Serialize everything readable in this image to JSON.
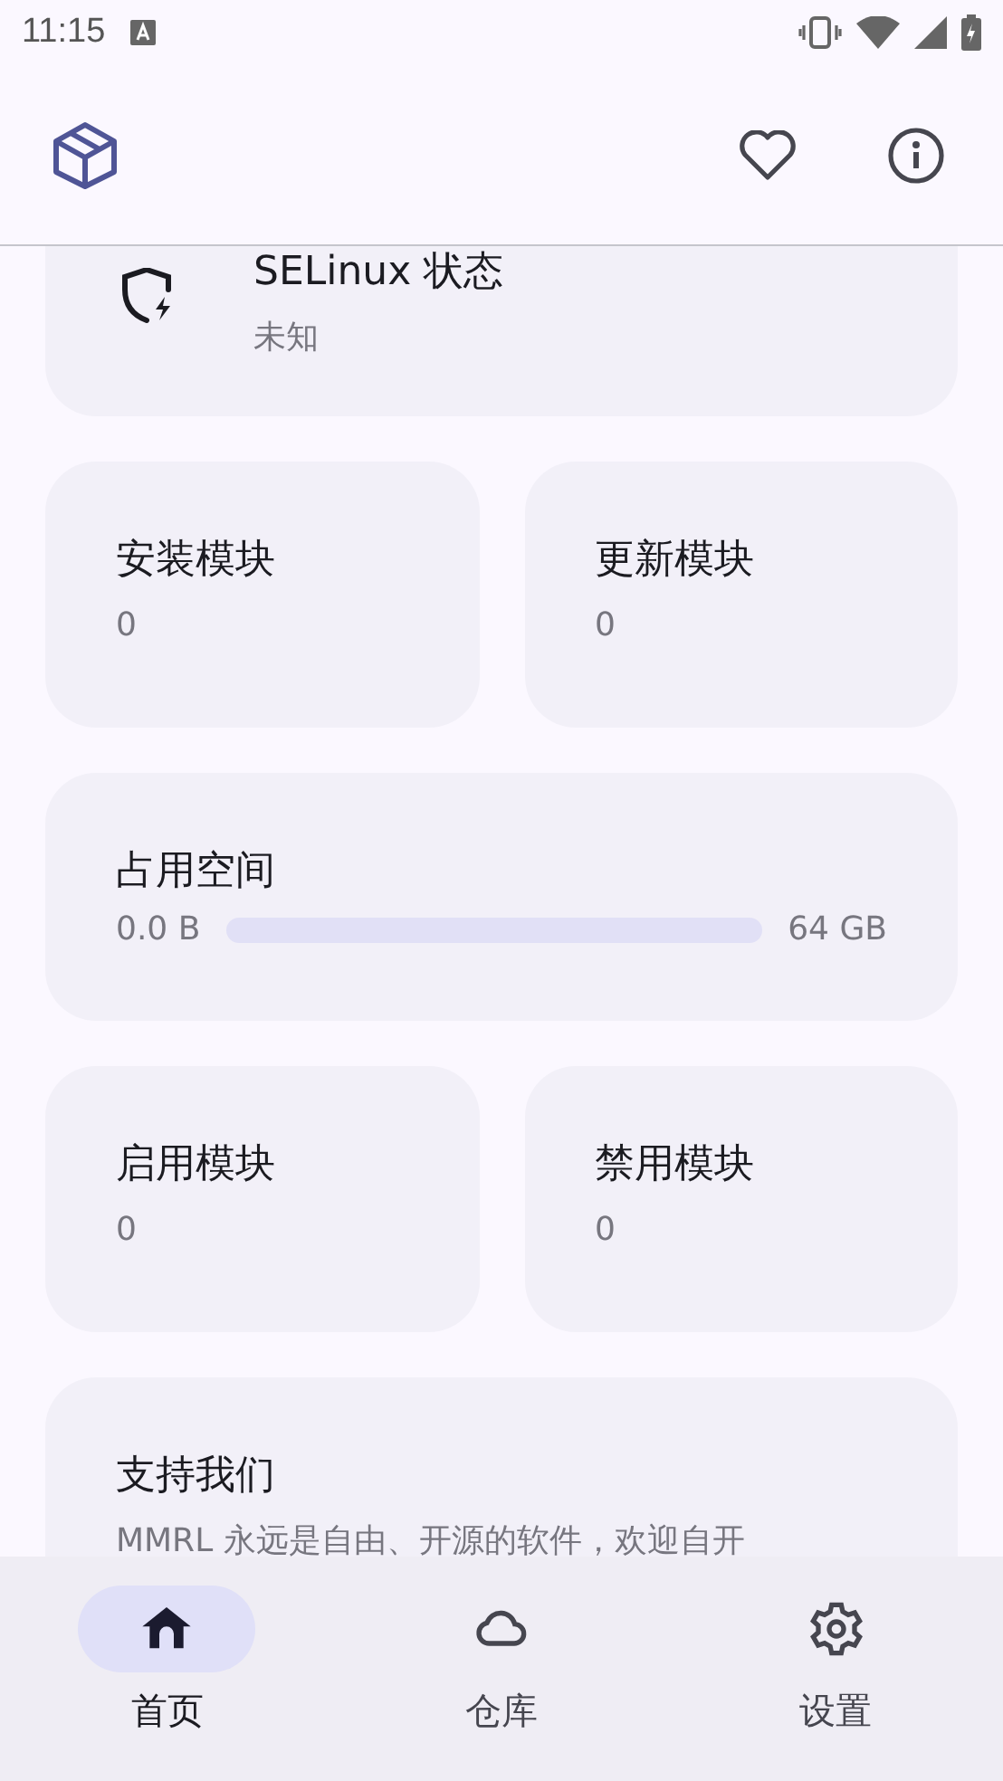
{
  "status_bar": {
    "time": "11:15"
  },
  "selinux_card": {
    "title": "SELinux 状态",
    "value": "未知"
  },
  "stat_rows": [
    [
      {
        "title": "安装模块",
        "value": "0"
      },
      {
        "title": "更新模块",
        "value": "0"
      }
    ]
  ],
  "storage_card": {
    "title": "占用空间",
    "used": "0.0 B",
    "total": "64 GB",
    "level": 0
  },
  "stat_rows_2": [
    [
      {
        "title": "启用模块",
        "value": "0"
      },
      {
        "title": "禁用模块",
        "value": "0"
      }
    ]
  ],
  "support_card": {
    "title": "支持我们",
    "text": "MMRL 永远是自由、开源的软件，欢迎自开"
  },
  "nav": [
    {
      "label": "首页",
      "kind": "home",
      "selected": true
    },
    {
      "label": "仓库",
      "kind": "cloud",
      "selected": false
    },
    {
      "label": "设置",
      "kind": "gear",
      "selected": false
    }
  ]
}
